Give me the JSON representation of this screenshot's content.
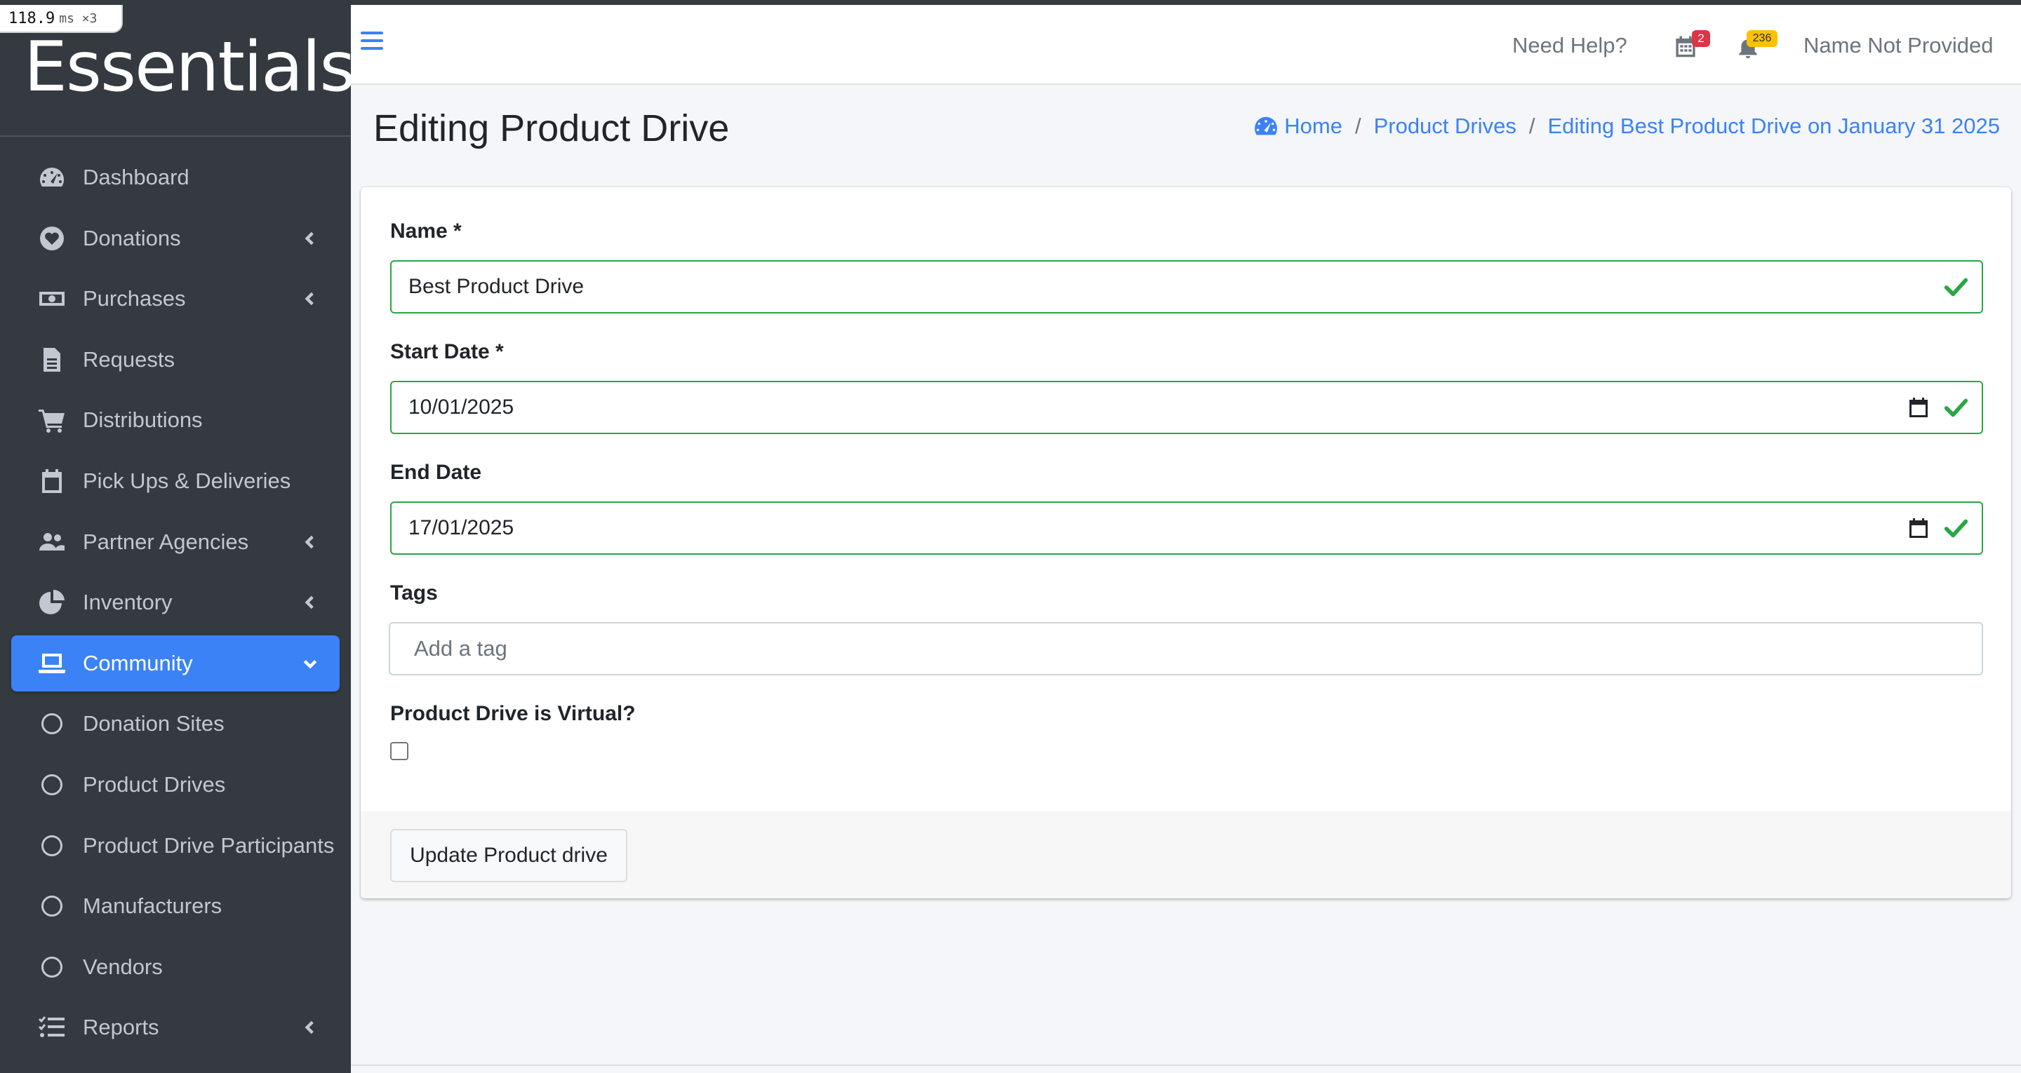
{
  "perf": {
    "value": "118.9",
    "unit": "ms ×3"
  },
  "brand": {
    "name": "Essentials"
  },
  "sidebar": {
    "items": [
      {
        "label": "Dashboard",
        "icon": "dashboard-icon",
        "has_chevron": false
      },
      {
        "label": "Donations",
        "icon": "heart-icon",
        "has_chevron": true
      },
      {
        "label": "Purchases",
        "icon": "money-bill-icon",
        "has_chevron": true
      },
      {
        "label": "Requests",
        "icon": "file-icon",
        "has_chevron": false
      },
      {
        "label": "Distributions",
        "icon": "cart-icon",
        "has_chevron": false
      },
      {
        "label": "Pick Ups & Deliveries",
        "icon": "calendar-icon",
        "has_chevron": false
      },
      {
        "label": "Partner Agencies",
        "icon": "users-icon",
        "has_chevron": true
      },
      {
        "label": "Inventory",
        "icon": "pie-chart-icon",
        "has_chevron": true
      },
      {
        "label": "Community",
        "icon": "laptop-icon",
        "has_chevron": true,
        "active": true,
        "expanded": true
      },
      {
        "label": "Donation Sites",
        "icon": "circle-icon",
        "has_chevron": false
      },
      {
        "label": "Product Drives",
        "icon": "circle-icon",
        "has_chevron": false
      },
      {
        "label": "Product Drive Participants",
        "icon": "circle-icon",
        "has_chevron": false
      },
      {
        "label": "Manufacturers",
        "icon": "circle-icon",
        "has_chevron": false
      },
      {
        "label": "Vendors",
        "icon": "circle-icon",
        "has_chevron": false
      },
      {
        "label": "Reports",
        "icon": "list-check-icon",
        "has_chevron": true
      }
    ]
  },
  "topbar": {
    "help": "Need Help?",
    "calendar_badge": "2",
    "bell_badge": "236",
    "user_name": "Name Not Provided"
  },
  "page": {
    "title": "Editing Product Drive",
    "breadcrumb": {
      "home": "Home",
      "product_drives": "Product Drives",
      "current": "Editing Best Product Drive on January 31 2025",
      "separator": "/"
    }
  },
  "form": {
    "name_label": "Name *",
    "name_value": "Best Product Drive",
    "start_label": "Start Date *",
    "start_value": "10/01/2025",
    "end_label": "End Date",
    "end_value": "17/01/2025",
    "tags_label": "Tags",
    "tags_placeholder": "Add a tag",
    "virtual_label": "Product Drive is Virtual?",
    "virtual_checked": false,
    "submit_label": "Update Product drive"
  },
  "colors": {
    "sidebar_bg": "#343a40",
    "accent": "#3b82f6",
    "valid": "#28a745",
    "badge_red": "#dc3545",
    "badge_yellow": "#ffc107"
  }
}
